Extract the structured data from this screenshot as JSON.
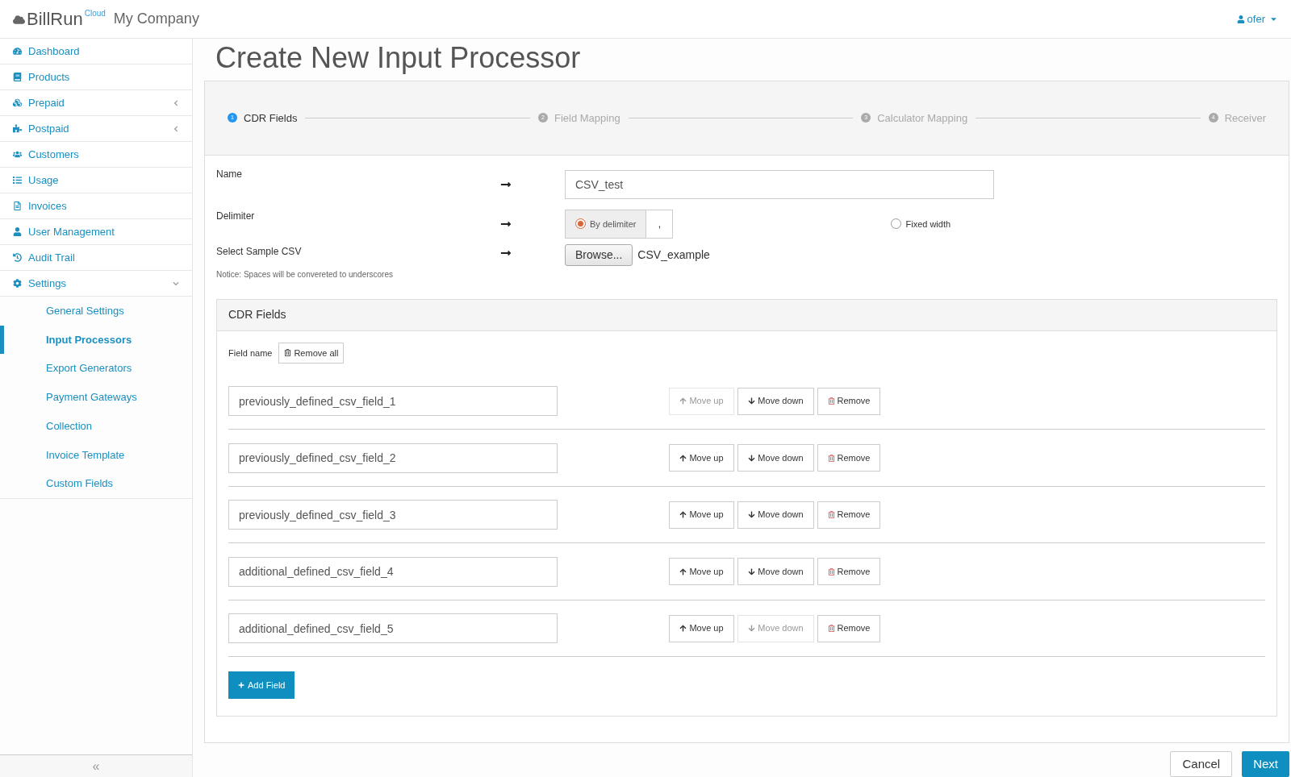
{
  "header": {
    "logo_text": "BillRun",
    "logo_sup": "Cloud",
    "company": "My Company",
    "user": "ofer"
  },
  "sidebar": {
    "items": [
      {
        "label": "Dashboard"
      },
      {
        "label": "Products"
      },
      {
        "label": "Prepaid",
        "expanded": false
      },
      {
        "label": "Postpaid",
        "expanded": false
      },
      {
        "label": "Customers"
      },
      {
        "label": "Usage"
      },
      {
        "label": "Invoices"
      },
      {
        "label": "User Management"
      },
      {
        "label": "Audit Trail"
      },
      {
        "label": "Settings",
        "expanded": true,
        "children": [
          {
            "label": "General Settings",
            "selected": false
          },
          {
            "label": "Input Processors",
            "selected": true
          },
          {
            "label": "Export Generators",
            "selected": false
          },
          {
            "label": "Payment Gateways",
            "selected": false
          },
          {
            "label": "Collection",
            "selected": false
          },
          {
            "label": "Invoice Template",
            "selected": false
          },
          {
            "label": "Custom Fields",
            "selected": false
          }
        ]
      }
    ],
    "collapse": "«"
  },
  "page_title": "Create New Input Processor",
  "steps": [
    {
      "number": "1",
      "label": "CDR Fields",
      "selected": true
    },
    {
      "number": "2",
      "label": "Field Mapping",
      "selected": false
    },
    {
      "number": "3",
      "label": "Calculator Mapping",
      "selected": false
    },
    {
      "number": "4",
      "label": "Receiver",
      "selected": false
    }
  ],
  "form": {
    "name": {
      "label": "Name",
      "value": "CSV_test"
    },
    "delimiter": {
      "label": "Delimiter",
      "options": [
        {
          "label": "By delimiter",
          "selected": true,
          "value": ","
        },
        {
          "label": "Fixed width",
          "selected": false
        }
      ]
    },
    "sample": {
      "label": "Select Sample CSV",
      "notice": "Notice: Spaces will be convereted to underscores",
      "button": "Browse...",
      "file": "CSV_example"
    }
  },
  "cdr_fields": {
    "title": "CDR Fields",
    "field_name_label": "Field name",
    "remove_all": "Remove all",
    "add_field": "Add Field",
    "rows": [
      {
        "value": "previously_defined_csv_field_1",
        "move_up": "Move up",
        "move_down": "Move down",
        "remove": "Remove",
        "move_up_disabled": true,
        "move_down_disabled": false
      },
      {
        "value": "previously_defined_csv_field_2",
        "move_up": "Move up",
        "move_down": "Move down",
        "remove": "Remove",
        "move_up_disabled": false,
        "move_down_disabled": false
      },
      {
        "value": "previously_defined_csv_field_3",
        "move_up": "Move up",
        "move_down": "Move down",
        "remove": "Remove",
        "move_up_disabled": false,
        "move_down_disabled": false
      },
      {
        "value": "additional_defined_csv_field_4",
        "move_up": "Move up",
        "move_down": "Move down",
        "remove": "Remove",
        "move_up_disabled": false,
        "move_down_disabled": false
      },
      {
        "value": "additional_defined_csv_field_5",
        "move_up": "Move up",
        "move_down": "Move down",
        "remove": "Remove",
        "move_up_disabled": false,
        "move_down_disabled": true
      }
    ]
  },
  "footer": {
    "cancel": "Cancel",
    "next": "Next"
  }
}
